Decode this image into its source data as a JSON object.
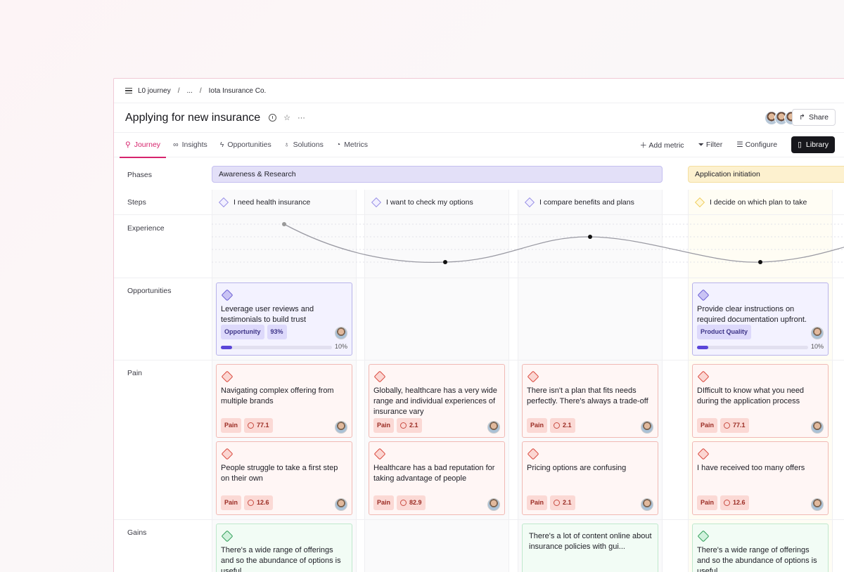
{
  "breadcrumb": {
    "root": "L0 journey",
    "ellipsis": "...",
    "current": "Iota Insurance Co."
  },
  "page": {
    "title": "Applying for new insurance",
    "share_label": "Share"
  },
  "tabs": [
    {
      "label": "Journey",
      "icon": "journey-icon",
      "active": true
    },
    {
      "label": "Insights",
      "icon": "binoculars-icon"
    },
    {
      "label": "Opportunities",
      "icon": "bolt-icon"
    },
    {
      "label": "Solutions",
      "icon": "lightbulb-icon"
    },
    {
      "label": "Metrics",
      "icon": "gauge-icon"
    }
  ],
  "toolbar": {
    "add_metric": "Add metric",
    "filter": "Filter",
    "configure": "Configure",
    "library": "Library"
  },
  "rows": {
    "phases": "Phases",
    "steps": "Steps",
    "experience": "Experience",
    "opportunities": "Opportunities",
    "pain": "Pain",
    "gains": "Gains"
  },
  "phases": [
    {
      "label": "Awareness & Research",
      "color": "#e3e0f8"
    },
    {
      "label": "Application initiation",
      "color": "#fdf1cf"
    }
  ],
  "steps": [
    "I need health insurance",
    "I want to check my options",
    "I compare benefits and plans",
    "I decide on which plan to take"
  ],
  "opportunities": [
    {
      "text": "Leverage user reviews and testimonials to build trust",
      "tags": [
        "Opportunity",
        "93%"
      ],
      "progress": 0.1,
      "progress_label": "10%"
    },
    {
      "text": "Provide clear instructions on required documentation upfront.",
      "tags": [
        "Product Quality"
      ],
      "progress": 0.1,
      "progress_label": "10%"
    }
  ],
  "pain": [
    [
      {
        "text": "Navigating complex offering from multiple brands",
        "tag": "Pain",
        "metric": "77.1"
      },
      {
        "text": "People struggle to take a first step on their own",
        "tag": "Pain",
        "metric": "12.6"
      }
    ],
    [
      {
        "text": "Globally, healthcare has a very wide range and individual experiences of insurance vary",
        "tag": "Pain",
        "metric": "2.1"
      },
      {
        "text": "Healthcare has a bad reputation for taking advantage of people",
        "tag": "Pain",
        "metric": "82.9"
      }
    ],
    [
      {
        "text": "There isn't a plan that fits needs perfectly. There's always a trade-off",
        "tag": "Pain",
        "metric": "2.1"
      },
      {
        "text": "Pricing options are confusing",
        "tag": "Pain",
        "metric": "2.1"
      }
    ],
    [
      {
        "text": "DIfficult to know what you need during the application process",
        "tag": "Pain",
        "metric": "77.1"
      },
      {
        "text": "I have received too many offers",
        "tag": "Pain",
        "metric": "12.6"
      }
    ]
  ],
  "gains": [
    {
      "text": "There's a wide range of offerings and so the abundance of options is useful"
    },
    {
      "text": "There's a lot of content online about insurance policies with gui..."
    },
    {
      "text": "There's a wide range of offerings and so the abundance of options is useful"
    }
  ],
  "colors": {
    "accent": "#d6246d",
    "pain": "#d9473c",
    "gain": "#2f9d57",
    "opportunity": "#6b5fd3"
  }
}
